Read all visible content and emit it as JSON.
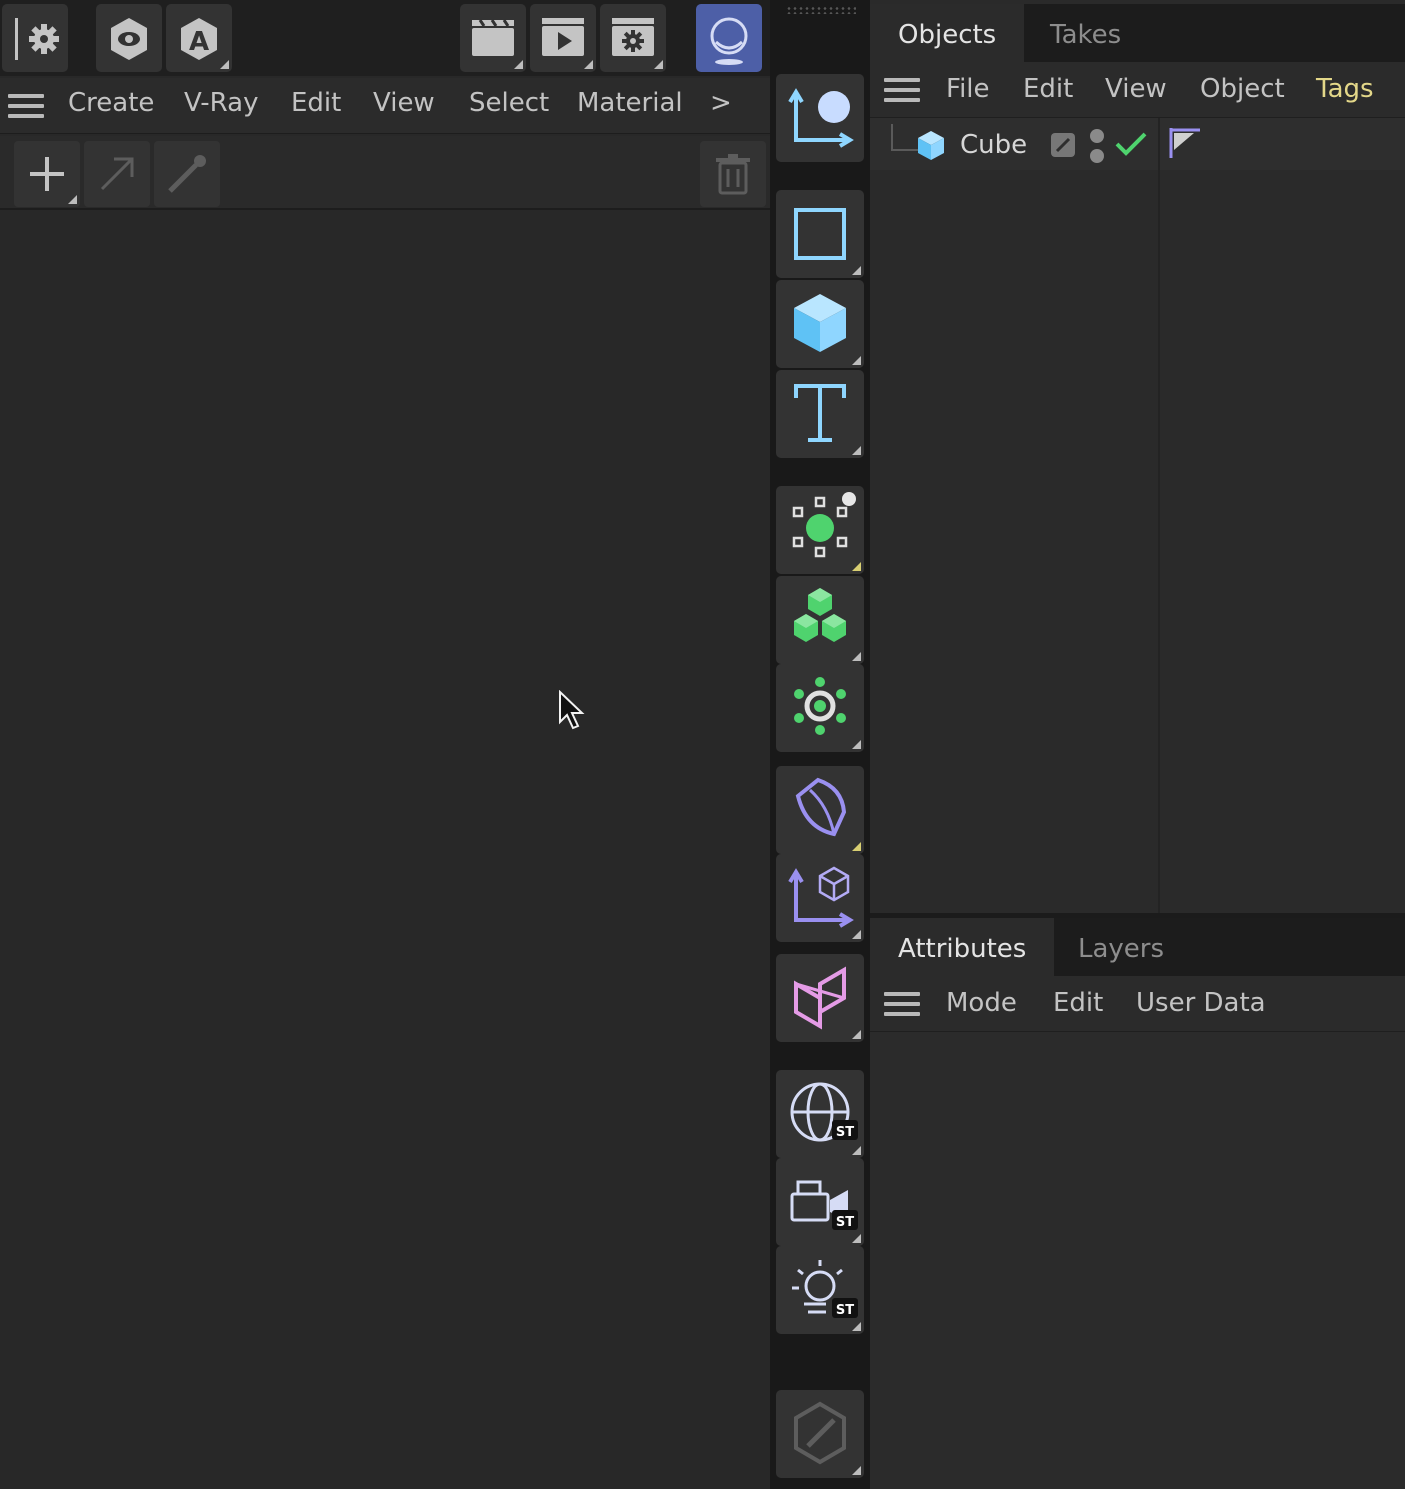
{
  "material_menu": {
    "items": [
      "Create",
      "V-Ray",
      "Edit",
      "View",
      "Select",
      "Material"
    ],
    "more": ">"
  },
  "objects_panel": {
    "tabs": [
      "Objects",
      "Takes"
    ],
    "menu": [
      "File",
      "Edit",
      "View",
      "Object",
      "Tags"
    ],
    "active_menu_color": "#e3d789",
    "object": {
      "name": "Cube",
      "icon": "cube-icon"
    }
  },
  "attributes_panel": {
    "tabs": [
      "Attributes",
      "Layers"
    ],
    "menu": [
      "Mode",
      "Edit",
      "User Data"
    ]
  },
  "toolbar_icons": [
    "settings-icon",
    "eye-icon",
    "auto-icon",
    "clapboard-icon",
    "play-clapboard-icon",
    "render-settings-icon",
    "vray-vision-icon"
  ],
  "palette_icons": [
    "move-object-icon",
    "square-spline-icon",
    "cube-icon",
    "text-icon",
    "generator-icon",
    "cloner-icon",
    "field-icon",
    "deformer-icon",
    "camera-object-icon",
    "vray-infinite-plane-icon",
    "vray-dome-icon",
    "vray-camera-icon",
    "vray-sun-icon",
    "edit-icon"
  ],
  "colors": {
    "accent_blue": "#8fd6ff",
    "accent_green": "#4fd36e",
    "accent_purple": "#9a90f0",
    "accent_pink": "#e49be6",
    "vray_button": "#4d5fa7"
  }
}
